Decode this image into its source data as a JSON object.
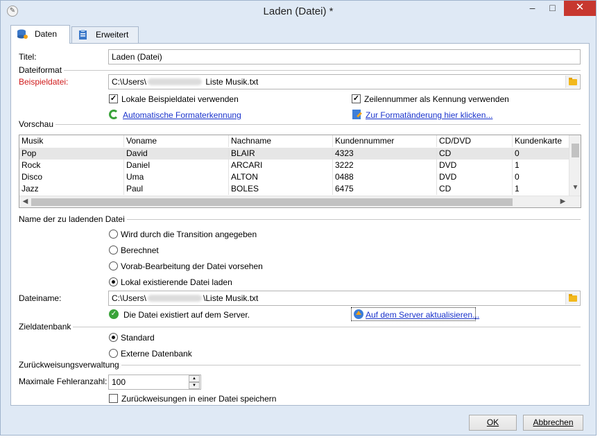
{
  "window": {
    "title": "Laden (Datei) *",
    "minimize": "–",
    "maximize": "□",
    "close": "✕"
  },
  "tabs": [
    {
      "label": "Daten",
      "icon": "database-icon",
      "active": true
    },
    {
      "label": "Erweitert",
      "icon": "clipboard-icon",
      "active": false
    }
  ],
  "form": {
    "title_label": "Titel:",
    "title_value": "Laden (Datei)",
    "section_format": "Dateiformat",
    "sample_label": "Beispieldatei:",
    "sample_prefix": "C:\\Users\\",
    "sample_suffix": " Liste Musik.txt",
    "use_local_sample": "Lokale Beispieldatei verwenden",
    "use_line_number": "Zeilennummer als Kennung verwenden",
    "auto_detect_link": "Automatische Formaterkennung",
    "change_format_link": "Zur Formatänderung hier klicken...",
    "section_preview": "Vorschau",
    "section_filename": "Name der zu ladenden Datei",
    "radio_transition": "Wird durch die Transition angegeben",
    "radio_computed": "Berechnet",
    "radio_preprocess": "Vorab-Bearbeitung der Datei vorsehen",
    "radio_local": "Lokal existierende Datei laden",
    "filename_label": "Dateiname:",
    "filename_prefix": "C:\\Users\\",
    "filename_suffix": "\\Liste Musik.txt",
    "file_exists": "Die Datei existiert auf dem Server.",
    "update_server_link": "Auf dem Server aktualisieren...",
    "section_target_db": "Zieldatenbank",
    "radio_standard": "Standard",
    "radio_external_db": "Externe Datenbank",
    "section_rejects": "Zurückweisungsverwaltung",
    "max_errors_label": "Maximale Fehleranzahl:",
    "max_errors_value": "100",
    "save_rejects": "Zurückweisungen in einer Datei speichern"
  },
  "preview": {
    "columns": [
      "Musik",
      "Voname",
      "Nachname",
      "Kundennummer",
      "CD/DVD",
      "Kundenkarte"
    ],
    "rows": [
      [
        "Pop",
        "David",
        "BLAIR",
        "4323",
        "CD",
        "0"
      ],
      [
        "Rock",
        "Daniel",
        "ARCARI",
        "3222",
        "DVD",
        "1"
      ],
      [
        "Disco",
        "Uma",
        "ALTON",
        "0488",
        "DVD",
        "0"
      ],
      [
        "Jazz",
        "Paul",
        "BOLES",
        "6475",
        "CD",
        "1"
      ]
    ]
  },
  "buttons": {
    "ok": "OK",
    "cancel": "Abbrechen"
  }
}
